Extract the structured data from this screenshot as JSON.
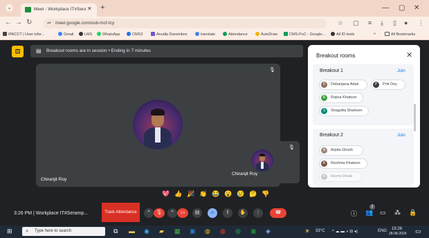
{
  "browser": {
    "tab_title": "Meet - Workplace IT#Seramp...",
    "url": "meet.google.com/osb-mcf-tcy",
    "bookmarks": [
      "IPACCT | User infor...",
      "Gmail",
      "LMS",
      "WhatsApp",
      "CMS3",
      "Anudip Darwinbox",
      "translate",
      "Attendance",
      "AutoDraw",
      "CMS-PoC - Google...",
      "All ID tools"
    ],
    "all_bookmarks": "All Bookmarks"
  },
  "meet": {
    "banner": "Breakout rooms are in session  •  Ending in 7 minutes",
    "main_tile_name": "Chiranjit Roy",
    "small_tile_name": "Chiranjit Roy",
    "meeting_info": "3:26 PM  |  Workplace IT#Seramp...",
    "track_attendance": "Track Attendance",
    "participant_count": "2",
    "reactions": [
      "💖",
      "👍",
      "🎉",
      "👏",
      "😂",
      "😮",
      "😢",
      "🤔",
      "👎"
    ]
  },
  "breakout_panel": {
    "title": "Breakout rooms",
    "rooms": [
      {
        "name": "Breakout 1",
        "join": "Join",
        "members": [
          "Debanjana Adak",
          "Priti Dey",
          "Rojina Khatoon",
          "Shagufta Shaheen"
        ]
      },
      {
        "name": "Breakout 2",
        "join": "Join",
        "members": [
          "Arpita Ghosh",
          "Reshma Khatoon",
          "Rozmi Dhaki"
        ]
      }
    ]
  },
  "taskbar": {
    "search_placeholder": "Type here to search",
    "temperature": "33°C",
    "language": "ENG",
    "time": "15:26",
    "date": "28-08-2024"
  }
}
